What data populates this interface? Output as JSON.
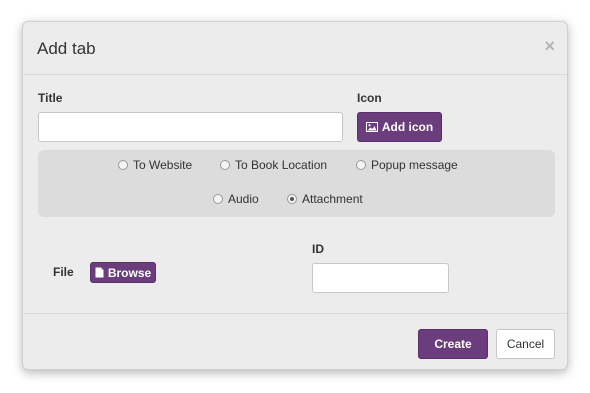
{
  "dialog": {
    "title": "Add tab",
    "close_symbol": "×"
  },
  "form": {
    "title_label": "Title",
    "title_value": "",
    "icon_label": "Icon",
    "add_icon_label": "Add icon",
    "link_types": [
      {
        "label": "To Website",
        "checked": false
      },
      {
        "label": "To Book Location",
        "checked": false
      },
      {
        "label": "Popup message",
        "checked": false
      },
      {
        "label": "Audio",
        "checked": false
      },
      {
        "label": "Attachment",
        "checked": true
      }
    ],
    "file_label": "File",
    "browse_label": "Browse",
    "id_label": "ID",
    "id_value": ""
  },
  "footer": {
    "create_label": "Create",
    "cancel_label": "Cancel"
  },
  "colors": {
    "accent": "#6b3d7d"
  },
  "icons": {
    "add_icon": "image-icon",
    "browse": "file-icon",
    "close": "close-icon"
  }
}
